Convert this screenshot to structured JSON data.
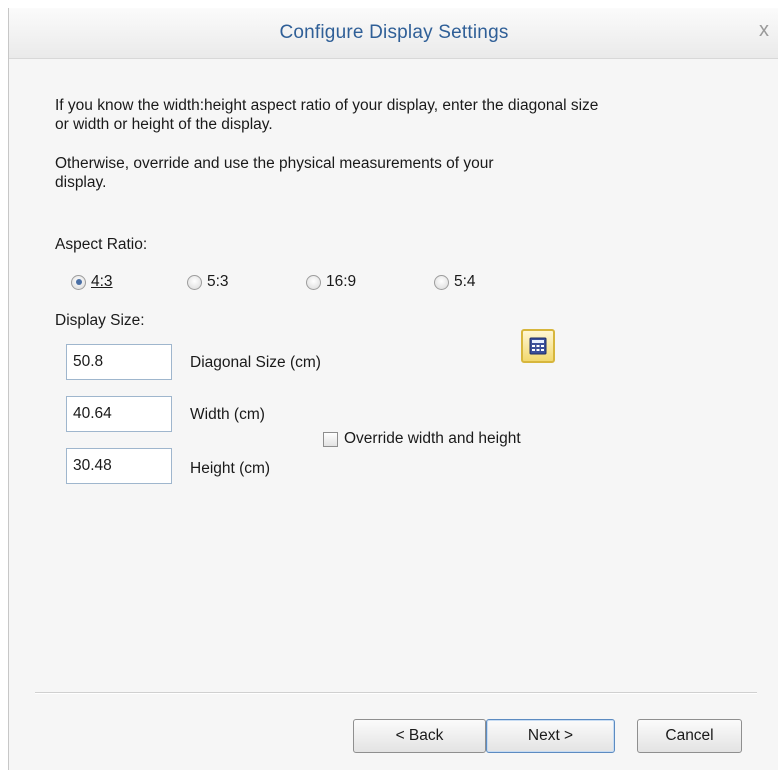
{
  "window": {
    "title": "Configure Display Settings",
    "close_label": "x"
  },
  "intro": {
    "line1": "If you know the width:height aspect ratio of your display, enter the diagonal size or width or height of the display.",
    "line2": "Otherwise, override and use the physical measurements of your display."
  },
  "aspect": {
    "label": "Aspect Ratio:",
    "options": [
      {
        "label": "4:3",
        "checked": true
      },
      {
        "label": "5:3",
        "checked": false
      },
      {
        "label": "16:9",
        "checked": false
      },
      {
        "label": "5:4",
        "checked": false
      }
    ]
  },
  "display_size": {
    "label": "Display Size:",
    "diagonal": {
      "value": "50.8",
      "label": "Diagonal Size (cm)"
    },
    "width": {
      "value": "40.64",
      "label": "Width (cm)"
    },
    "height": {
      "value": "30.48",
      "label": "Height (cm)"
    },
    "calculator_icon": "calculator-icon"
  },
  "override": {
    "label": "Override width and height",
    "checked": false
  },
  "buttons": {
    "back": "< Back",
    "next": "Next >",
    "cancel": "Cancel"
  },
  "colors": {
    "title_text": "#2f5f97",
    "radio_selected": "#4a6fa5",
    "calculator_border": "#d7b63c"
  }
}
